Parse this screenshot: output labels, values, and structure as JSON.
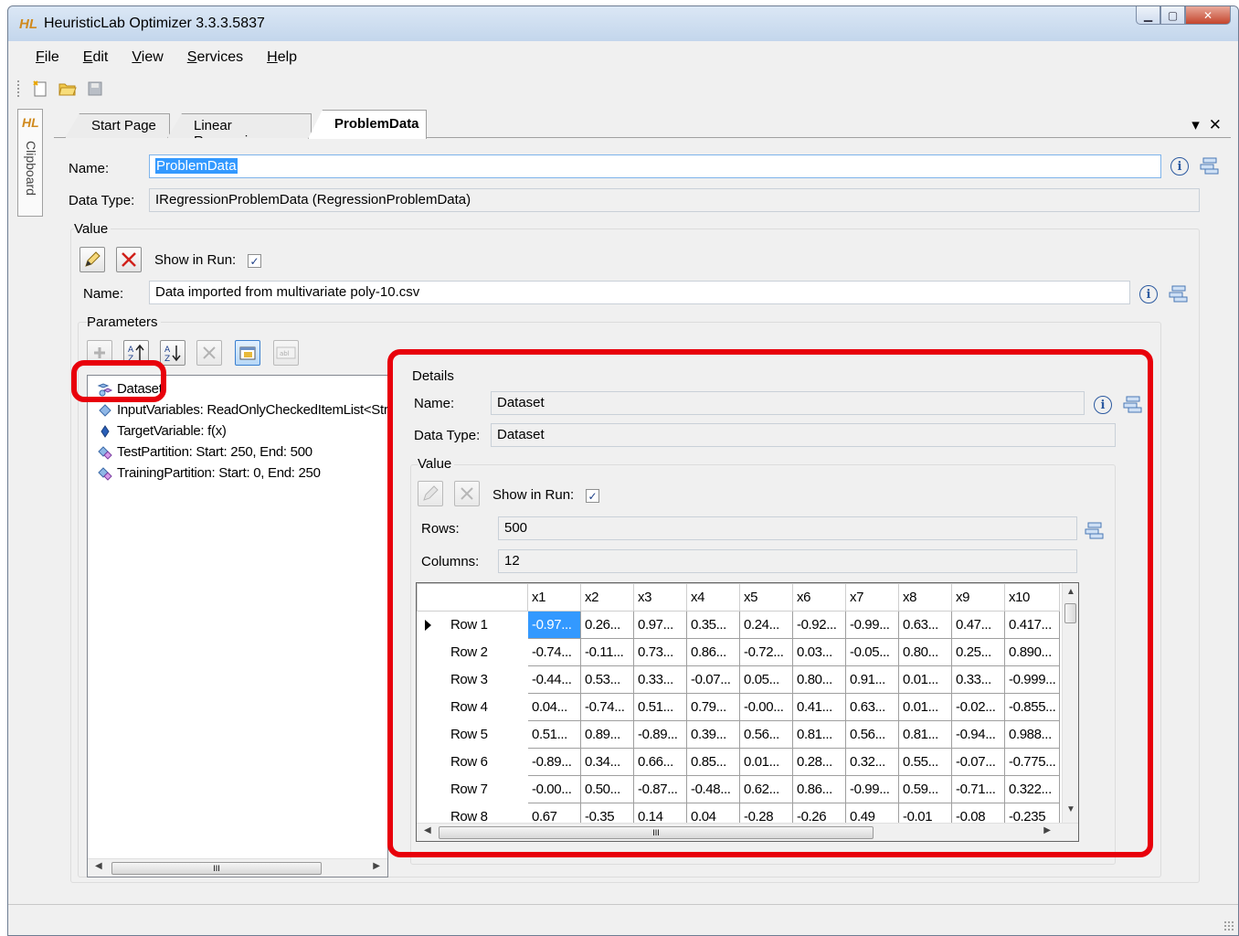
{
  "window": {
    "logo": "HL",
    "title": "HeuristicLab Optimizer 3.3.3.5837"
  },
  "menu": [
    "File",
    "Edit",
    "View",
    "Services",
    "Help"
  ],
  "sidebar": {
    "logo": "HL",
    "label": "Clipboard"
  },
  "tabs": [
    {
      "label": "Start Page",
      "active": false
    },
    {
      "label": "Linear Regression",
      "active": false
    },
    {
      "label": "ProblemData",
      "active": true
    }
  ],
  "tab_controls": {
    "dropdown": "▾",
    "close": "✕"
  },
  "top": {
    "name_label": "Name:",
    "name_value": "ProblemData",
    "datatype_label": "Data Type:",
    "datatype_value": "IRegressionProblemData (RegressionProblemData)"
  },
  "value": {
    "title": "Value",
    "show_in_run_label": "Show in Run:",
    "show_in_run_checked": "✓",
    "name_label": "Name:",
    "name_value": "Data imported from multivariate poly-10.csv"
  },
  "parameters": {
    "title": "Parameters",
    "items": [
      "Dataset",
      "InputVariables: ReadOnlyCheckedItemList<Str",
      "TargetVariable: f(x)",
      "TestPartition: Start: 250, End: 500",
      "TrainingPartition: Start: 0, End: 250"
    ]
  },
  "details": {
    "title": "Details",
    "name_label": "Name:",
    "name_value": "Dataset",
    "datatype_label": "Data Type:",
    "datatype_value": "Dataset",
    "value_title": "Value",
    "show_in_run_label": "Show in Run:",
    "show_in_run_checked": "✓",
    "rows_label": "Rows:",
    "rows_value": "500",
    "columns_label": "Columns:",
    "columns_value": "12"
  },
  "grid": {
    "columns": [
      "x1",
      "x2",
      "x3",
      "x4",
      "x5",
      "x6",
      "x7",
      "x8",
      "x9",
      "x10"
    ],
    "rows": [
      {
        "label": "Row 1",
        "cells": [
          "-0.97...",
          "0.26...",
          "0.97...",
          "0.35...",
          "0.24...",
          "-0.92...",
          "-0.99...",
          "0.63...",
          "0.47...",
          "0.417..."
        ]
      },
      {
        "label": "Row 2",
        "cells": [
          "-0.74...",
          "-0.11...",
          "0.73...",
          "0.86...",
          "-0.72...",
          "0.03...",
          "-0.05...",
          "0.80...",
          "0.25...",
          "0.890..."
        ]
      },
      {
        "label": "Row 3",
        "cells": [
          "-0.44...",
          "0.53...",
          "0.33...",
          "-0.07...",
          "0.05...",
          "0.80...",
          "0.91...",
          "0.01...",
          "0.33...",
          "-0.999..."
        ]
      },
      {
        "label": "Row 4",
        "cells": [
          "0.04...",
          "-0.74...",
          "0.51...",
          "0.79...",
          "-0.00...",
          "0.41...",
          "0.63...",
          "0.01...",
          "-0.02...",
          "-0.855..."
        ]
      },
      {
        "label": "Row 5",
        "cells": [
          "0.51...",
          "0.89...",
          "-0.89...",
          "0.39...",
          "0.56...",
          "0.81...",
          "0.56...",
          "0.81...",
          "-0.94...",
          "0.988..."
        ]
      },
      {
        "label": "Row 6",
        "cells": [
          "-0.89...",
          "0.34...",
          "0.66...",
          "0.85...",
          "0.01...",
          "0.28...",
          "0.32...",
          "0.55...",
          "-0.07...",
          "-0.775..."
        ]
      },
      {
        "label": "Row 7",
        "cells": [
          "-0.00...",
          "0.50...",
          "-0.87...",
          "-0.48...",
          "0.62...",
          "0.86...",
          "-0.99...",
          "0.59...",
          "-0.71...",
          "0.322..."
        ]
      },
      {
        "label": "Row 8",
        "cells": [
          "0.67",
          "-0.35",
          "0.14",
          "0.04",
          "-0.28",
          "-0.26",
          "0.49",
          "-0.01",
          "-0.08",
          "-0.235"
        ]
      }
    ],
    "scroll_grip": "III"
  },
  "tree_scroll_grip": "III"
}
